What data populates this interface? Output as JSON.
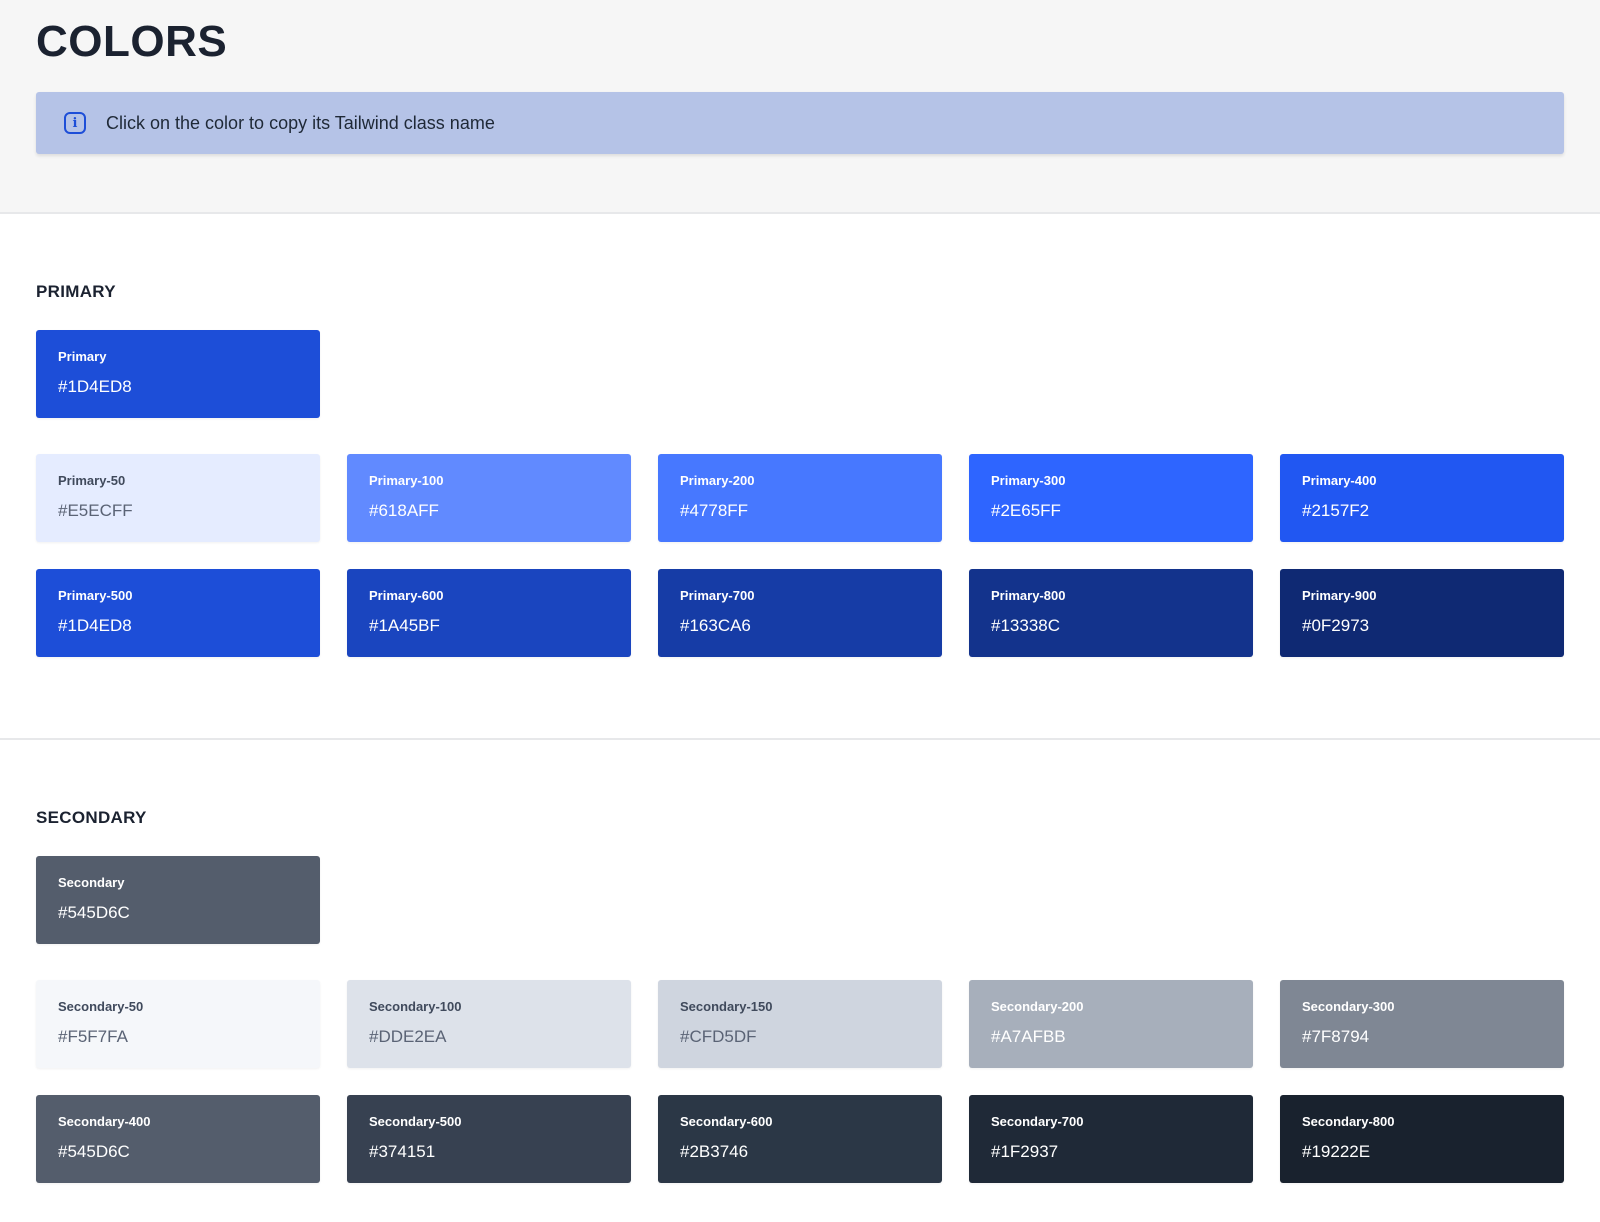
{
  "page": {
    "title": "COLORS",
    "info_text": "Click on the color to copy its Tailwind class name"
  },
  "primary": {
    "title": "PRIMARY",
    "base": {
      "name": "Primary",
      "hex": "#1D4ED8",
      "color": "#1D4ED8",
      "text": "dark"
    },
    "shades": [
      {
        "name": "Primary-50",
        "hex": "#E5ECFF",
        "color": "#E5ECFF",
        "text": "light"
      },
      {
        "name": "Primary-100",
        "hex": "#618AFF",
        "color": "#618AFF",
        "text": "dark"
      },
      {
        "name": "Primary-200",
        "hex": "#4778FF",
        "color": "#4778FF",
        "text": "dark"
      },
      {
        "name": "Primary-300",
        "hex": "#2E65FF",
        "color": "#2E65FF",
        "text": "dark"
      },
      {
        "name": "Primary-400",
        "hex": "#2157F2",
        "color": "#2157F2",
        "text": "dark"
      },
      {
        "name": "Primary-500",
        "hex": "#1D4ED8",
        "color": "#1D4ED8",
        "text": "dark"
      },
      {
        "name": "Primary-600",
        "hex": "#1A45BF",
        "color": "#1A45BF",
        "text": "dark"
      },
      {
        "name": "Primary-700",
        "hex": "#163CA6",
        "color": "#163CA6",
        "text": "dark"
      },
      {
        "name": "Primary-800",
        "hex": "#13338C",
        "color": "#13338C",
        "text": "dark"
      },
      {
        "name": "Primary-900",
        "hex": "#0F2973",
        "color": "#0F2973",
        "text": "dark"
      }
    ]
  },
  "secondary": {
    "title": "SECONDARY",
    "base": {
      "name": "Secondary",
      "hex": "#545D6C",
      "color": "#545D6C",
      "text": "dark"
    },
    "shades": [
      {
        "name": "Secondary-50",
        "hex": "#F5F7FA",
        "color": "#F5F7FA",
        "text": "light"
      },
      {
        "name": "Secondary-100",
        "hex": "#DDE2EA",
        "color": "#DDE2EA",
        "text": "light"
      },
      {
        "name": "Secondary-150",
        "hex": "#CFD5DF",
        "color": "#CFD5DF",
        "text": "light"
      },
      {
        "name": "Secondary-200",
        "hex": "#A7AFBB",
        "color": "#A7AFBB",
        "text": "dark"
      },
      {
        "name": "Secondary-300",
        "hex": "#7F8794",
        "color": "#7F8794",
        "text": "dark"
      },
      {
        "name": "Secondary-400",
        "hex": "#545D6C",
        "color": "#545D6C",
        "text": "dark"
      },
      {
        "name": "Secondary-500",
        "hex": "#374151",
        "color": "#374151",
        "text": "dark"
      },
      {
        "name": "Secondary-600",
        "hex": "#2B3746",
        "color": "#2B3746",
        "text": "dark"
      },
      {
        "name": "Secondary-700",
        "hex": "#1F2937",
        "color": "#1F2937",
        "text": "dark"
      },
      {
        "name": "Secondary-800",
        "hex": "#19222E",
        "color": "#19222E",
        "text": "dark"
      }
    ]
  }
}
